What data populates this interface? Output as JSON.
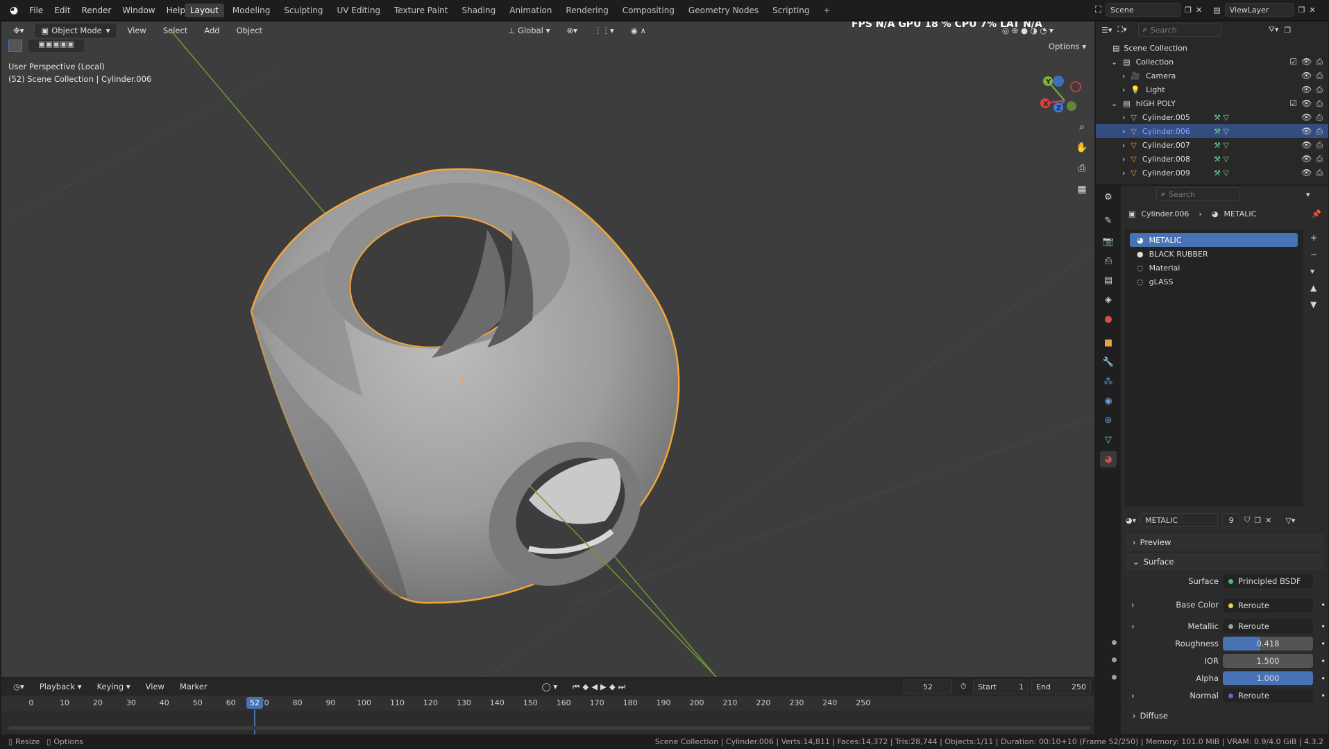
{
  "topbar": {
    "menus": [
      "File",
      "Edit",
      "Render",
      "Window",
      "Help"
    ],
    "workspaces": [
      "Layout",
      "Modeling",
      "Sculpting",
      "UV Editing",
      "Texture Paint",
      "Shading",
      "Animation",
      "Rendering",
      "Compositing",
      "Geometry Nodes",
      "Scripting"
    ],
    "active_workspace": "Layout",
    "scene": "Scene",
    "view_layer": "ViewLayer"
  },
  "viewport": {
    "mode": "Object Mode",
    "menus": [
      "View",
      "Select",
      "Add",
      "Object"
    ],
    "orientation": "Global",
    "options": "Options",
    "info_line1": "User Perspective (Local)",
    "info_line2": "(52) Scene Collection | Cylinder.006",
    "stats": "FPS N/A GPU 18 % CPU 7% LAT N/A",
    "gizmo": {
      "x": "X",
      "y": "Y",
      "z": "Z"
    }
  },
  "timeline": {
    "menus": [
      "Playback",
      "Keying",
      "View",
      "Marker"
    ],
    "current_frame": "52",
    "start_label": "Start",
    "start": "1",
    "end_label": "End",
    "end": "250",
    "ticks": [
      "0",
      "10",
      "20",
      "30",
      "40",
      "50",
      "60",
      "70",
      "80",
      "90",
      "100",
      "110",
      "120",
      "130",
      "140",
      "150",
      "160",
      "170",
      "180",
      "190",
      "200",
      "210",
      "220",
      "230",
      "240",
      "250"
    ],
    "frame_indicator": "52"
  },
  "outliner": {
    "search_placeholder": "Search",
    "root": "Scene Collection",
    "items": [
      {
        "label": "Collection",
        "level": 1,
        "type": "collection"
      },
      {
        "label": "Camera",
        "level": 2,
        "type": "camera"
      },
      {
        "label": "Light",
        "level": 2,
        "type": "light"
      },
      {
        "label": "hIGH POLY",
        "level": 1,
        "type": "collection"
      },
      {
        "label": "Cylinder.005",
        "level": 2,
        "type": "mesh"
      },
      {
        "label": "Cylinder.006",
        "level": 2,
        "type": "mesh",
        "selected": true
      },
      {
        "label": "Cylinder.007",
        "level": 2,
        "type": "mesh"
      },
      {
        "label": "Cylinder.008",
        "level": 2,
        "type": "mesh"
      },
      {
        "label": "Cylinder.009",
        "level": 2,
        "type": "mesh"
      }
    ]
  },
  "properties": {
    "search_placeholder": "Search",
    "breadcrumb_object": "Cylinder.006",
    "breadcrumb_material": "METALIC",
    "slots": [
      "METALIC",
      "BLACK RUBBER",
      "Material",
      "gLASS"
    ],
    "material_name": "METALIC",
    "users": "9",
    "sections": {
      "preview": "Preview",
      "surface": "Surface",
      "diffuse": "Diffuse"
    },
    "surface_label": "Surface",
    "surface_value": "Principled BSDF",
    "rows": [
      {
        "label": "Base Color",
        "value": "Reroute",
        "kind": "link",
        "dot": "#e8d24a"
      },
      {
        "label": "Metallic",
        "value": "Reroute",
        "kind": "link",
        "dot": "#a0a0a0"
      },
      {
        "label": "Roughness",
        "value": "0.418",
        "kind": "num",
        "fill": 0.418
      },
      {
        "label": "IOR",
        "value": "1.500",
        "kind": "num",
        "fill": 0
      },
      {
        "label": "Alpha",
        "value": "1.000",
        "kind": "num",
        "fill": 1.0
      },
      {
        "label": "Normal",
        "value": "Reroute",
        "kind": "link",
        "dot": "#6363c7"
      }
    ]
  },
  "statusbar": {
    "left1": "Resize",
    "left2": "Options",
    "right": "Scene Collection | Cylinder.006 | Verts:14,811 | Faces:14,372 | Tris:28,744 | Objects:1/11 | Duration: 00:10+10 (Frame 52/250) | Memory: 101.0 MiB | VRAM: 0.9/4.0 GiB | 4.3.2"
  },
  "colors": {
    "accent": "#4772b3",
    "select": "#f5a53a",
    "x_axis": "#e0413f",
    "y_axis": "#7bb43c",
    "z_axis": "#3c7be0"
  }
}
